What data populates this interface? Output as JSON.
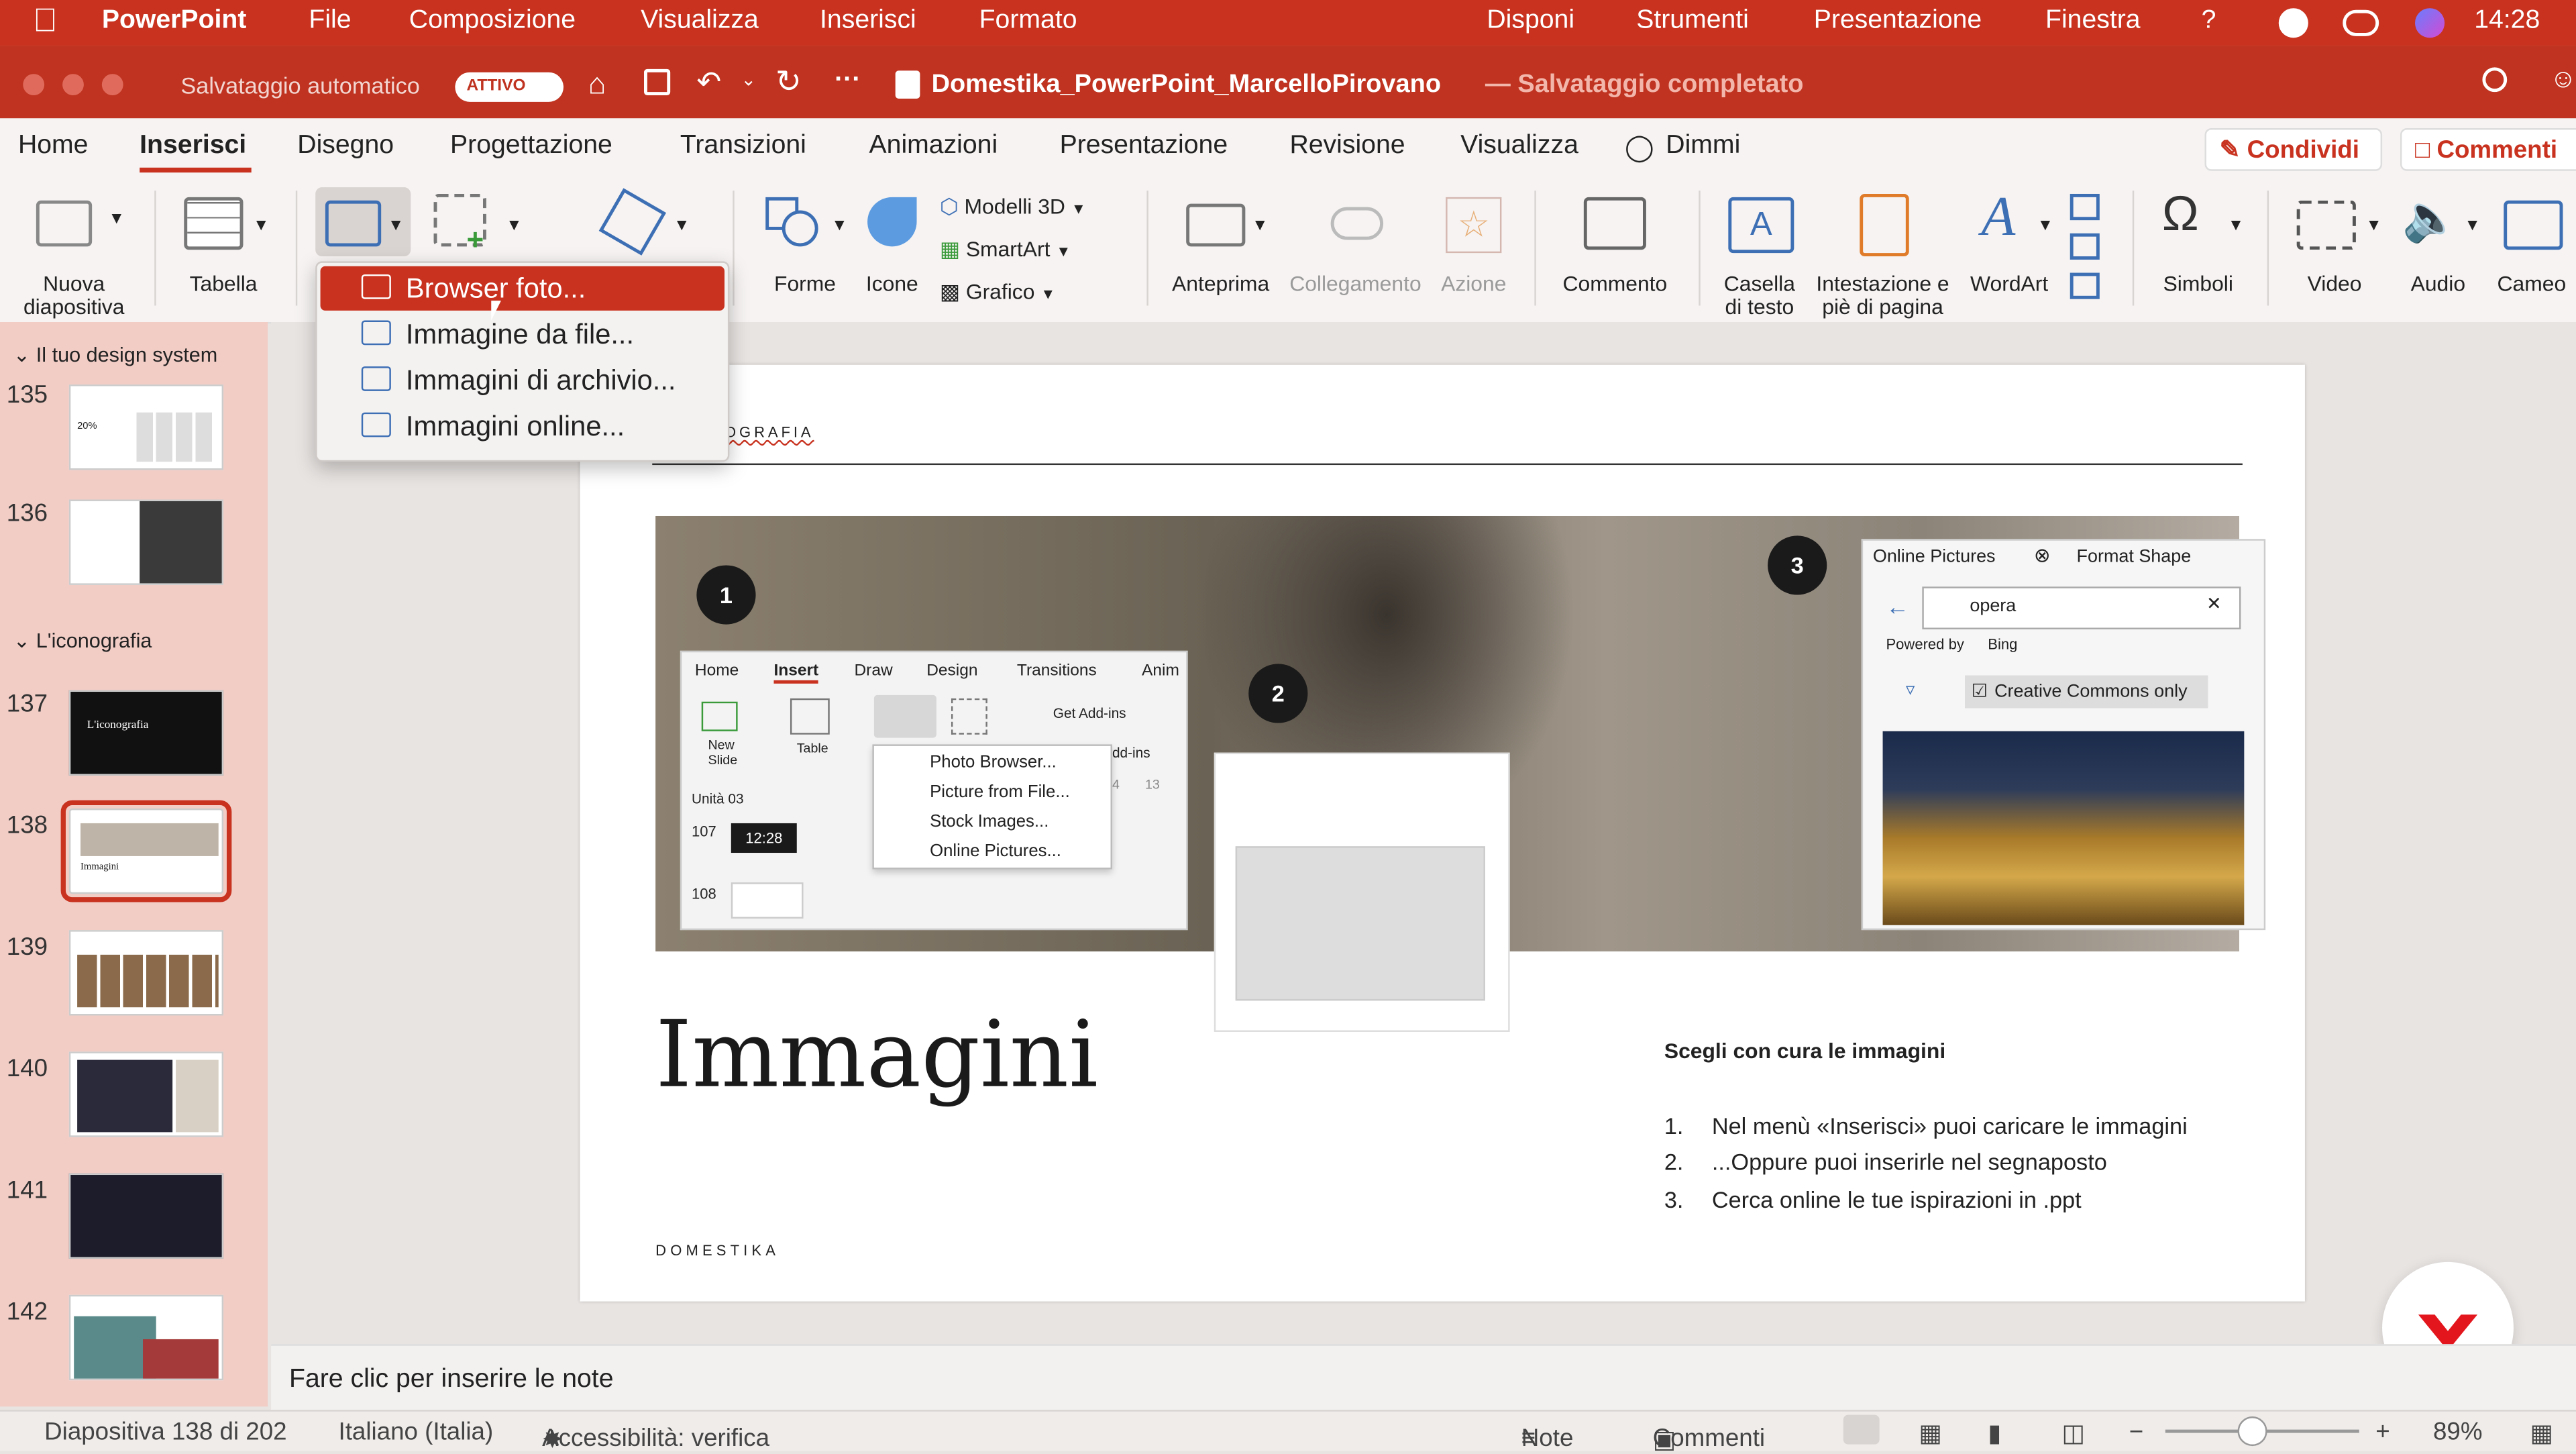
{
  "menubar": {
    "app": "PowerPoint",
    "items": [
      "File",
      "Composizione",
      "Visualizza",
      "Inserisci",
      "Formato"
    ],
    "right_items": [
      "Disponi",
      "Strumenti",
      "Presentazione",
      "Finestra",
      "?"
    ],
    "time": "14:28"
  },
  "titlebar": {
    "autosave_label": "Salvataggio automatico",
    "autosave_state": "ATTIVO",
    "filename": "Domestika_PowerPoint_MarcelloPirovano",
    "save_status": "— Salvataggio completato"
  },
  "tabs": [
    "Home",
    "Inserisci",
    "Disegno",
    "Progettazione",
    "Transizioni",
    "Animazioni",
    "Presentazione",
    "Revisione",
    "Visualizza"
  ],
  "tell_me": "Dimmi",
  "share_button": "Condividi",
  "comments_button": "Commenti",
  "ribbon": {
    "new_slide": [
      "Nuova",
      "diapositiva"
    ],
    "table": "Tabella",
    "shapes": "Forme",
    "icons": "Icone",
    "models3d": "Modelli 3D",
    "smartart": "SmartArt",
    "chart": "Grafico",
    "preview": "Anteprima",
    "link": "Collegamento",
    "action": "Azione",
    "comment": "Commento",
    "textbox": [
      "Casella",
      "di testo"
    ],
    "header_footer": [
      "Intestazione e",
      "piè di pagina"
    ],
    "wordart": "WordArt",
    "symbols": "Simboli",
    "video": "Video",
    "audio": "Audio",
    "cameo": "Cameo"
  },
  "dropdown": {
    "items": [
      "Browser foto...",
      "Immagine da file...",
      "Immagini di archivio...",
      "Immagini online..."
    ]
  },
  "leftpanel": {
    "sections": [
      "Il tuo design system",
      "L'iconografia"
    ],
    "slide_numbers": [
      "135",
      "136",
      "137",
      "138",
      "139",
      "140",
      "141",
      "142"
    ],
    "thumb137_text": "L'iconografia",
    "thumb138_text": "Immagini",
    "thumb135_text": "20%"
  },
  "slide": {
    "header_fragment": "OGRAFIA",
    "title": "Immagini",
    "footer": "DOMESTIKA",
    "badges": [
      "1",
      "2",
      "3"
    ],
    "choose_heading": "Scegli con cura le immagini",
    "list_numbers": [
      "1.",
      "2.",
      "3."
    ],
    "list": [
      "Nel menù «Inserisci» puoi caricare le immagini",
      "...Oppure puoi inserirle nel segnaposto",
      "Cerca online le tue ispirazioni in .ppt"
    ],
    "inner_ui": {
      "tabs": [
        "Home",
        "Insert",
        "Draw",
        "Design",
        "Transitions",
        "Anim"
      ],
      "new_slide": [
        "New",
        "Slide"
      ],
      "table": "Table",
      "get_addins": "Get Add-ins",
      "addins": "dd-ins",
      "menu": [
        "Photo Browser...",
        "Picture from File...",
        "Stock Images...",
        "Online Pictures..."
      ],
      "unit": "Unità 03",
      "thumb_nums": [
        "107",
        "108"
      ],
      "ruler": [
        "4",
        "13"
      ],
      "clock": "12:28"
    },
    "online_panel": {
      "tab1": "Online Pictures",
      "tab2": "Format Shape",
      "search": "opera",
      "powered": "Powered by",
      "bing": "Bing",
      "cc": "Creative Commons only"
    }
  },
  "notes_placeholder": "Fare clic per inserire le note",
  "status": {
    "slide": "Diapositiva 138 di 202",
    "language": "Italiano (Italia)",
    "accessibility": "Accessibilità: verifica",
    "notes": "Note",
    "comments": "Commenti",
    "zoom": "89%"
  },
  "colors": {
    "brand": "#c8321f",
    "accent_blue": "#3d6fb5"
  }
}
